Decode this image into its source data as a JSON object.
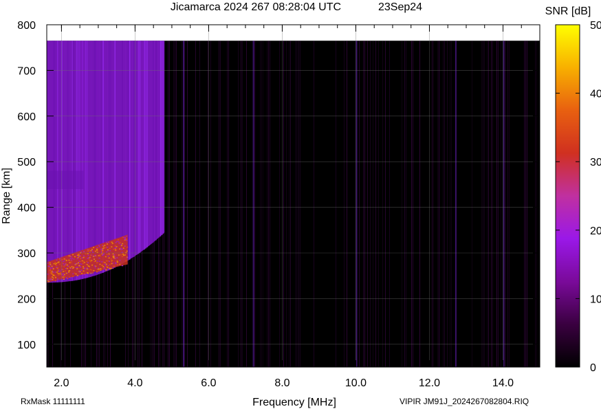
{
  "chart_data": {
    "type": "heatmap",
    "title": "Jicamarca 2024 267 08:28:04 UTC",
    "date_label": "23Sep24",
    "xlabel": "Frequency [MHz]",
    "ylabel": "Range [km]",
    "xlim": [
      1.6,
      15.0
    ],
    "ylim": [
      50,
      800
    ],
    "x_ticks": [
      "2.0",
      "4.0",
      "6.0",
      "8.0",
      "10.0",
      "12.0",
      "14.0"
    ],
    "y_ticks": [
      "100",
      "200",
      "300",
      "400",
      "500",
      "600",
      "700",
      "800"
    ],
    "data_top_range": 765,
    "grid": true,
    "colorbar": {
      "label": "SNR [dB]",
      "range": [
        0,
        50
      ],
      "ticks": [
        "0",
        "10",
        "20",
        "30",
        "40",
        "50"
      ],
      "colors": [
        "#000000",
        "#3a0040",
        "#7a0a9a",
        "#9a18e8",
        "#c030a0",
        "#d03020",
        "#e86010",
        "#f8b000",
        "#ffff00"
      ]
    },
    "regions": [
      {
        "name": "F-layer diffuse echo",
        "f_start": 1.6,
        "f_end": 4.8,
        "range_low": 250,
        "range_high": 765,
        "snr_db": 12
      },
      {
        "name": "F-layer trace core",
        "f_start": 1.6,
        "f_end": 3.8,
        "range_low": 235,
        "range_high": 340,
        "snr_db": 30
      },
      {
        "name": "Background noise",
        "f_start": 4.8,
        "f_end": 15.0,
        "range_low": 50,
        "range_high": 765,
        "snr_db": 2
      }
    ],
    "interference_lines_mhz": [
      5.3,
      7.2,
      10.0,
      12.7,
      14.0
    ]
  },
  "footer": {
    "rxmask": "RxMask 11111111",
    "file": "VIPIR  JM91J_2024267082804.RIQ"
  }
}
